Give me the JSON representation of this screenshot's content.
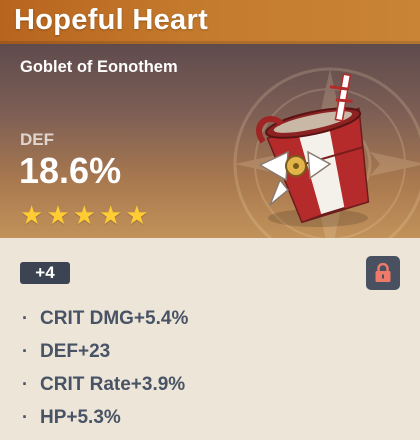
{
  "artifact": {
    "name": "Hopeful Heart",
    "type": "Goblet of Eonothem",
    "main_stat": {
      "name": "DEF",
      "value": "18.6%"
    },
    "rarity": 5,
    "level": "+4",
    "locked": true,
    "substats": [
      {
        "bullet": "·",
        "text": "CRIT DMG+5.4%"
      },
      {
        "bullet": "·",
        "text": "DEF+23"
      },
      {
        "bullet": "·",
        "text": "CRIT Rate+3.9%"
      },
      {
        "bullet": "·",
        "text": "HP+5.3%"
      }
    ]
  },
  "icons": {
    "star": "star-icon",
    "lock": "lock-icon",
    "artifact": "goblet-image"
  },
  "colors": {
    "title_bar": "#c47a2c",
    "star": "#ffcc33",
    "lock": "#f07a6a",
    "badge": "#3c4454",
    "substat_text": "#495366"
  }
}
